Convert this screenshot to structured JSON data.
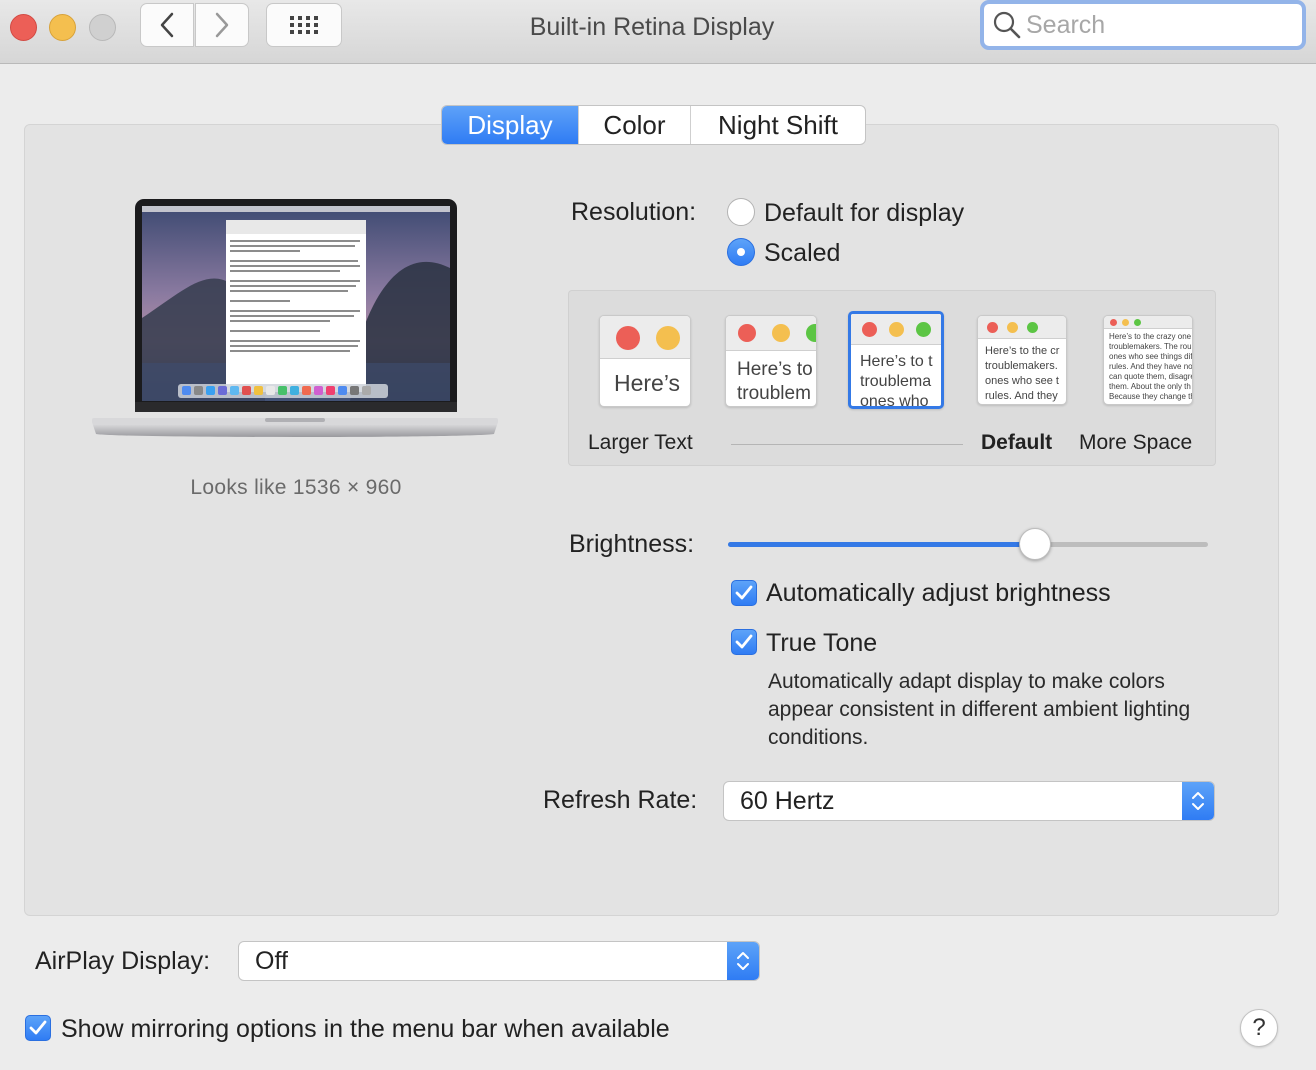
{
  "window": {
    "title": "Built-in Retina Display",
    "search_placeholder": "Search"
  },
  "tabs": [
    {
      "label": "Display",
      "active": true
    },
    {
      "label": "Color",
      "active": false
    },
    {
      "label": "Night Shift",
      "active": false
    }
  ],
  "preview": {
    "looks_like": "Looks like 1536 × 960"
  },
  "resolution": {
    "label": "Resolution:",
    "options": [
      {
        "label": "Default for display",
        "selected": false
      },
      {
        "label": "Scaled",
        "selected": true
      }
    ],
    "scale_labels": {
      "larger": "Larger Text",
      "default": "Default",
      "more": "More Space"
    },
    "thumbs": [
      {
        "text": "Here’s"
      },
      {
        "text": "Here’s to troublem"
      },
      {
        "text": "Here’s to t troublema ones who"
      },
      {
        "text": "Here’s to the cr troublemakers. ones who see t rules. And they"
      },
      {
        "text": "Here’s to the crazy one troublemakers. The rou ones who see things dif rules. And they have no can quote them, disagre them. About the only th Because they change th"
      }
    ],
    "selected_index": 2
  },
  "brightness": {
    "label": "Brightness:",
    "level_percent": 64
  },
  "auto_brightness": {
    "label": "Automatically adjust brightness",
    "checked": true
  },
  "true_tone": {
    "label": "True Tone",
    "checked": true,
    "description": "Automatically adapt display to make colors appear consistent in different ambient lighting conditions."
  },
  "refresh_rate": {
    "label": "Refresh Rate:",
    "value": "60 Hertz"
  },
  "airplay": {
    "label": "AirPlay Display:",
    "value": "Off"
  },
  "mirroring": {
    "label": "Show mirroring options in the menu bar when available",
    "checked": true
  },
  "help": {
    "label": "?"
  },
  "colors": {
    "accent": "#3479e6",
    "traffic_red": "#ec5f57",
    "traffic_yellow": "#f4bf4f",
    "traffic_green": "#5cc544"
  }
}
